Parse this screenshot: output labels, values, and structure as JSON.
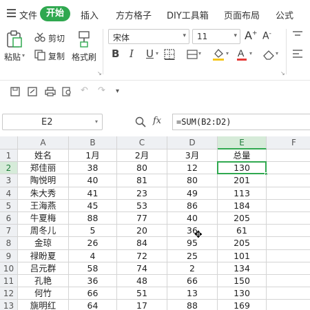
{
  "menu": {
    "file": "文件",
    "start": "开始",
    "insert": "插入",
    "fangfang": "方方格子",
    "diy": "DIY工具箱",
    "layout": "页面布局",
    "formula": "公式"
  },
  "ribbon": {
    "paste": "粘贴",
    "cut": "剪切",
    "copy": "复制",
    "format_painter": "格式刷",
    "font_name": "宋体",
    "font_size": "11"
  },
  "formula_bar": {
    "name_box": "E2",
    "fx": "fx",
    "formula": "=SUM(B2:D2)"
  },
  "columns": [
    "A",
    "B",
    "C",
    "D",
    "E",
    "F"
  ],
  "rows": [
    {
      "num": "1",
      "cells": [
        "姓名",
        "1月",
        "2月",
        "3月",
        "总量",
        ""
      ]
    },
    {
      "num": "2",
      "cells": [
        "郑佳丽",
        "38",
        "80",
        "12",
        "130",
        ""
      ]
    },
    {
      "num": "3",
      "cells": [
        "陶悦明",
        "40",
        "81",
        "80",
        "201",
        ""
      ]
    },
    {
      "num": "4",
      "cells": [
        "朱大秀",
        "41",
        "23",
        "49",
        "113",
        ""
      ]
    },
    {
      "num": "5",
      "cells": [
        "王海燕",
        "45",
        "53",
        "86",
        "184",
        ""
      ]
    },
    {
      "num": "6",
      "cells": [
        "牛夏梅",
        "88",
        "77",
        "40",
        "205",
        ""
      ]
    },
    {
      "num": "7",
      "cells": [
        "周冬儿",
        "5",
        "20",
        "36",
        "61",
        ""
      ]
    },
    {
      "num": "8",
      "cells": [
        "金琼",
        "26",
        "84",
        "95",
        "205",
        ""
      ]
    },
    {
      "num": "9",
      "cells": [
        "禄盼夏",
        "4",
        "72",
        "25",
        "101",
        ""
      ]
    },
    {
      "num": "10",
      "cells": [
        "吕元群",
        "58",
        "74",
        "2",
        "134",
        ""
      ]
    },
    {
      "num": "11",
      "cells": [
        "孔艳",
        "36",
        "48",
        "66",
        "150",
        ""
      ]
    },
    {
      "num": "12",
      "cells": [
        "何竹",
        "66",
        "51",
        "13",
        "130",
        ""
      ]
    },
    {
      "num": "13",
      "cells": [
        "旐明红",
        "64",
        "17",
        "88",
        "169",
        ""
      ]
    }
  ],
  "colors": {
    "accent": "#2fa84f",
    "header_bg": "#eef0f3",
    "active_header_bg": "#d6ebd9"
  }
}
